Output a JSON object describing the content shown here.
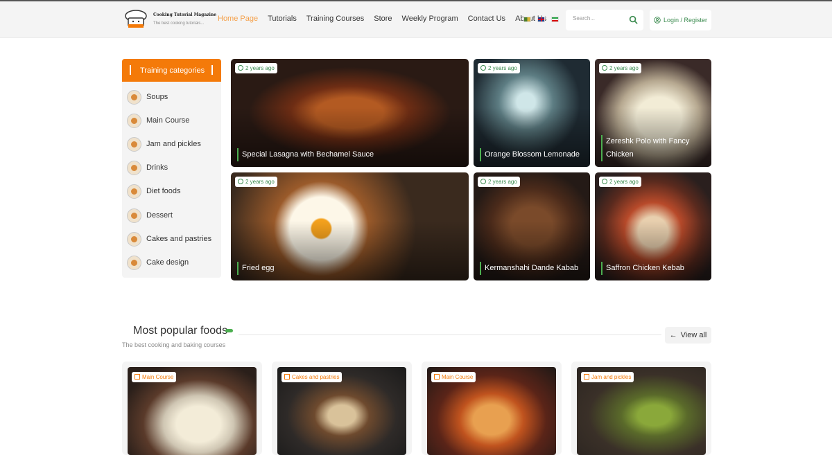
{
  "header": {
    "logo": {
      "title": "Cooking Tutorial Magazine",
      "subtitle": "The best cooking tutorials..."
    },
    "nav": [
      "Home Page",
      "Tutorials",
      "Training Courses",
      "Store",
      "Weekly Program",
      "Contact Us",
      "About Us"
    ],
    "search": {
      "placeholder": "Search..."
    },
    "login_label": "Login / Register"
  },
  "sidebar": {
    "title": "Training categories",
    "items": [
      {
        "label": "Soups"
      },
      {
        "label": "Main Course"
      },
      {
        "label": "Jam and pickles"
      },
      {
        "label": "Drinks"
      },
      {
        "label": "Diet foods"
      },
      {
        "label": "Dessert"
      },
      {
        "label": "Cakes and pastries"
      },
      {
        "label": "Cake design"
      }
    ]
  },
  "featured": [
    {
      "time": "2 years ago",
      "title": "Special Lasagna with Bechamel Sauce"
    },
    {
      "time": "2 years ago",
      "title": "Orange Blossom Lemonade"
    },
    {
      "time": "2 years ago",
      "title": "Zereshk Polo with Fancy Chicken"
    },
    {
      "time": "2 years ago",
      "title": "Fried egg"
    },
    {
      "time": "2 years ago",
      "title": "Kermanshahi Dande Kabab"
    },
    {
      "time": "2 years ago",
      "title": "Saffron Chicken Kebab"
    }
  ],
  "popular": {
    "title": "Most popular foods",
    "subtitle": "The best cooking and baking courses",
    "view_all": "View all",
    "cards": [
      {
        "category": "Main Course"
      },
      {
        "category": "Cakes and pastries"
      },
      {
        "category": "Main Course"
      },
      {
        "category": "Jam and pickles"
      }
    ]
  },
  "colors": {
    "accent_orange": "#f47a09",
    "accent_green": "#4caf50",
    "nav_active": "#f5a04a"
  }
}
